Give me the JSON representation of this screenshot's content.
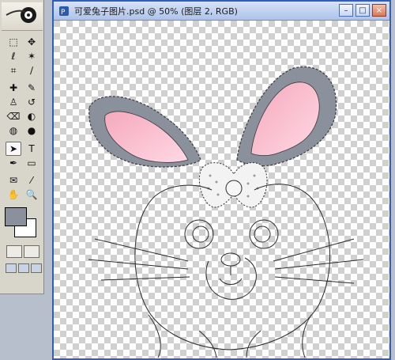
{
  "document": {
    "title": "可爱兔子图片.psd @ 50% (图层 2, RGB)",
    "icon": "photoshop-doc-icon",
    "buttons": {
      "minimize": "–",
      "maximize": "□",
      "close": "×"
    }
  },
  "toolbox": {
    "tools": [
      {
        "name": "marquee-tool",
        "glyph": "⬚"
      },
      {
        "name": "move-tool",
        "glyph": "✥"
      },
      {
        "name": "lasso-tool",
        "glyph": "ℓ"
      },
      {
        "name": "magic-wand-tool",
        "glyph": "✶"
      },
      {
        "name": "crop-tool",
        "glyph": "⌗"
      },
      {
        "name": "slice-tool",
        "glyph": "∕"
      },
      {
        "name": "healing-brush-tool",
        "glyph": "✚"
      },
      {
        "name": "brush-tool",
        "glyph": "✎"
      },
      {
        "name": "clone-stamp-tool",
        "glyph": "♙"
      },
      {
        "name": "history-brush-tool",
        "glyph": "↺"
      },
      {
        "name": "eraser-tool",
        "glyph": "⌫"
      },
      {
        "name": "bucket-tool",
        "glyph": "◐"
      },
      {
        "name": "dodge-tool",
        "glyph": "◍"
      },
      {
        "name": "burn-tool",
        "glyph": "●"
      },
      {
        "name": "path-selection-tool",
        "glyph": "➤"
      },
      {
        "name": "type-tool",
        "glyph": "T"
      },
      {
        "name": "pen-tool",
        "glyph": "✒"
      },
      {
        "name": "shape-tool",
        "glyph": "▭"
      },
      {
        "name": "notes-tool",
        "glyph": "✉"
      },
      {
        "name": "eyedropper-tool",
        "glyph": "⁄"
      },
      {
        "name": "hand-tool",
        "glyph": "✋"
      },
      {
        "name": "zoom-tool",
        "glyph": "🔍"
      }
    ],
    "foreground_color": "#8a919d",
    "background_color": "#ffffff"
  },
  "colors": {
    "ear_gray": "#8a919d",
    "ear_pink": "#f6b4c6",
    "checker_light": "#ffffff",
    "checker_dark": "#d0d0d0",
    "title_accent": "#2f5fb8"
  }
}
